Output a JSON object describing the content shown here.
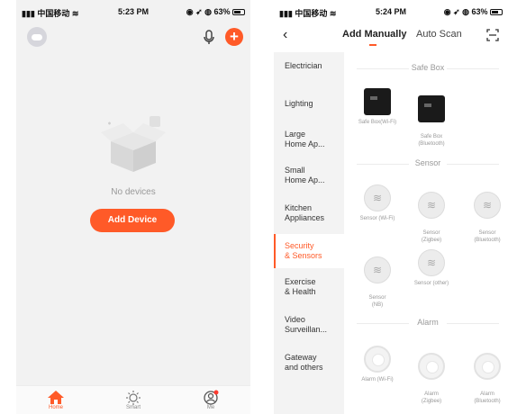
{
  "left": {
    "status": {
      "carrier": "中国移动",
      "time": "5:23 PM",
      "battery": "63%"
    },
    "empty_text": "No devices",
    "add_button": "Add Device",
    "tabs": [
      {
        "label": "Home",
        "icon": "home-icon",
        "active": true
      },
      {
        "label": "Smart",
        "icon": "sun-icon",
        "active": false
      },
      {
        "label": "Me",
        "icon": "profile-icon",
        "active": false
      }
    ]
  },
  "right": {
    "status": {
      "carrier": "中国移动",
      "time": "5:24 PM",
      "battery": "63%"
    },
    "tabs": {
      "add_manually": "Add Manually",
      "auto_scan": "Auto Scan"
    },
    "categories": [
      "Electrician",
      "Lighting",
      "Large\nHome Ap...",
      "Small\nHome Ap...",
      "Kitchen\nAppliances",
      "Security\n& Sensors",
      "Exercise\n& Health",
      "Video\nSurveillan...",
      "Gateway\nand others"
    ],
    "active_category": "Security\n& Sensors",
    "sections": [
      {
        "title": "Safe Box",
        "devices": [
          "Safe Box(Wi-Fi)",
          "Safe Box\n(Bluetooth)"
        ]
      },
      {
        "title": "Sensor",
        "devices": [
          "Sensor (Wi-Fi)",
          "Sensor\n(Zigbee)",
          "Sensor\n(Bluetooth)",
          "Sensor\n(NB)",
          "Sensor (other)"
        ]
      },
      {
        "title": "Alarm",
        "devices": [
          "Alarm (Wi-Fi)",
          "Alarm\n(Zigbee)",
          "Alarm\n(Bluetooth)"
        ]
      }
    ]
  }
}
